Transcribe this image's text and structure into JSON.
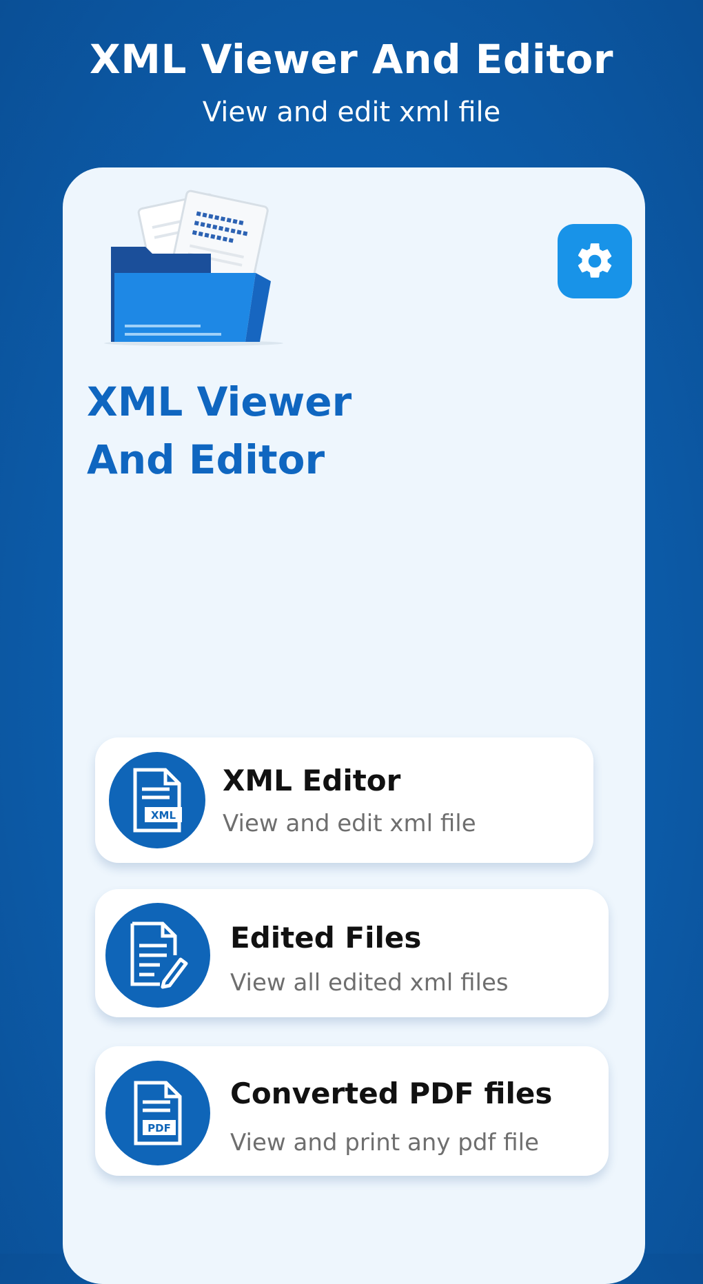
{
  "promo": {
    "title": "XML Viewer And Editor",
    "subtitle": "View and edit xml file"
  },
  "app": {
    "name_line1": "XML Viewer",
    "name_line2": "And Editor",
    "settings_icon": "gear-icon",
    "hero_icon": "folder-documents-icon"
  },
  "menu": [
    {
      "title": "XML Editor",
      "subtitle": "View and edit xml file",
      "icon": "xml-document-icon",
      "icon_badge": "XML"
    },
    {
      "title": "Edited Files",
      "subtitle": "View all edited xml files",
      "icon": "edit-document-icon"
    },
    {
      "title": "Converted PDF files",
      "subtitle": "View and print any pdf file",
      "icon": "pdf-document-icon",
      "icon_badge": "PDF"
    }
  ],
  "colors": {
    "background": "#0d5fae",
    "screen": "#eef6fd",
    "accent": "#1893e8",
    "brand_text": "#0f66c0",
    "icon_circle": "#0f65b8"
  }
}
